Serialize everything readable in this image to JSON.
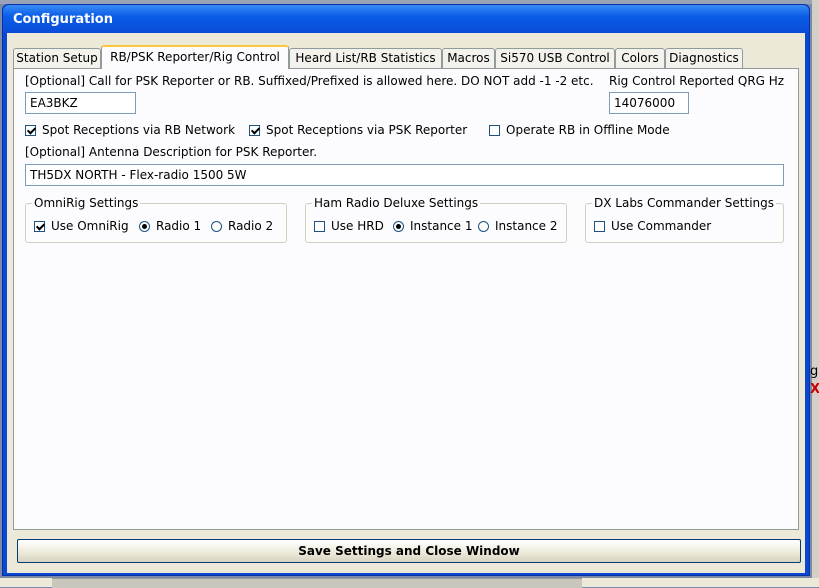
{
  "window": {
    "title": "Configuration"
  },
  "tabs": [
    {
      "label": "Station Setup",
      "active": false
    },
    {
      "label": "RB/PSK Reporter/Rig Control",
      "active": true
    },
    {
      "label": "Heard List/RB Statistics",
      "active": false
    },
    {
      "label": "Macros",
      "active": false
    },
    {
      "label": "Si570 USB Control",
      "active": false
    },
    {
      "label": "Colors",
      "active": false
    },
    {
      "label": "Diagnostics",
      "active": false
    }
  ],
  "panel": {
    "call_label": "[Optional] Call for PSK Reporter or RB.  Suffixed/Prefixed is allowed here.  DO NOT add -1 -2 etc.",
    "call_value": "EA3BKZ",
    "qrg_label": "Rig Control Reported QRG Hz",
    "qrg_value": "14076000",
    "checks": [
      {
        "label": "Spot Receptions via RB Network",
        "checked": true
      },
      {
        "label": "Spot Receptions via PSK Reporter",
        "checked": true
      },
      {
        "label": "Operate RB in Offline Mode",
        "checked": false
      }
    ],
    "antenna_label": "[Optional] Antenna Description for PSK Reporter.",
    "antenna_value": "TH5DX NORTH  - Flex-radio 1500 5W",
    "omnirig": {
      "title": "OmniRig Settings",
      "use_label": "Use OmniRig",
      "use_checked": true,
      "radio1_label": "Radio 1",
      "radio1_selected": true,
      "radio2_label": "Radio 2",
      "radio2_selected": false
    },
    "hrd": {
      "title": "Ham Radio Deluxe Settings",
      "use_label": "Use HRD",
      "use_checked": false,
      "inst1_label": "Instance 1",
      "inst1_selected": true,
      "inst2_label": "Instance 2",
      "inst2_selected": false
    },
    "dxlabs": {
      "title": "DX Labs Commander Settings",
      "use_label": "Use Commander",
      "use_checked": false
    }
  },
  "save_button": "Save Settings and Close Window",
  "background": {
    "right_glyph_1": "g",
    "right_glyph_2": "X"
  }
}
